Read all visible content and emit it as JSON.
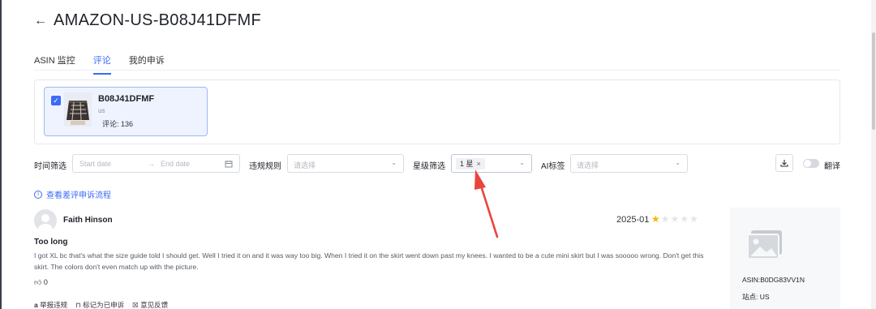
{
  "header": {
    "back_icon": "arrow-left-icon",
    "title": "AMAZON-US-B08J41DFMF"
  },
  "tabs": [
    {
      "label": "ASIN 监控",
      "active": false
    },
    {
      "label": "评论",
      "active": true
    },
    {
      "label": "我的申诉",
      "active": false
    }
  ],
  "product": {
    "asin": "B08J41DFMF",
    "site": "us",
    "review_count_label": "评论: 136",
    "selected": true
  },
  "filters": {
    "time": {
      "label": "时间筛选",
      "start_placeholder": "Start date",
      "end_placeholder": "End date",
      "separator": "→"
    },
    "violation": {
      "label": "违规规则",
      "placeholder": "请选择"
    },
    "star": {
      "label": "星级筛选",
      "selected_tag": "1 星",
      "remove": "×"
    },
    "ai": {
      "label": "AI标签",
      "placeholder": "请选择"
    },
    "translate_label": "翻译",
    "translate_on": false
  },
  "appeal_link": "查看差评申诉流程",
  "review": {
    "reviewer": "Faith Hinson",
    "date": "2025-01",
    "rating": 1,
    "title": "Too long",
    "body": "I got XL bc that's what the size guide told I should get. Well I tried it on and it was way too big. When I tried it on the skirt went down past my knees. I wanted to be a cute mini skirt but I was sooooo wrong. Don't get this skirt. The colors don't even match up with the picture.",
    "likes": "0",
    "actions": [
      "举报违规",
      "标记为已申诉",
      "意见反馈"
    ]
  },
  "side": {
    "asin": "ASIN:B0DG83VV1N",
    "site": "站点: US"
  },
  "colors": {
    "accent": "#3b6cf6",
    "star": "#f7b500",
    "arrow": "#e8453c"
  }
}
